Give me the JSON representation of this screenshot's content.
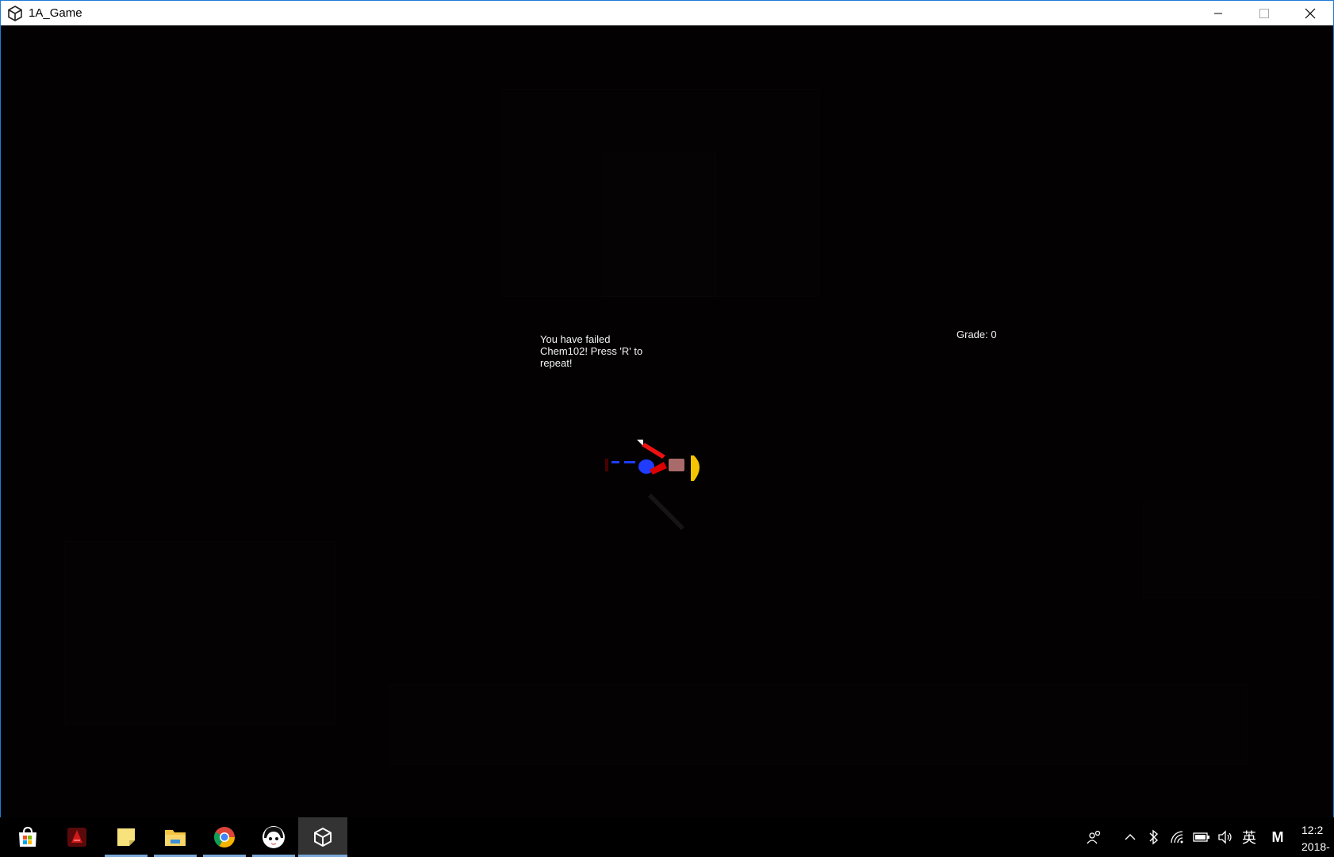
{
  "window": {
    "title": "1A_Game",
    "controls": [
      "minimize-icon",
      "maximize-icon",
      "close-icon"
    ]
  },
  "game": {
    "fail_message": "You have failed Chem102! Press 'R' to repeat!",
    "grade_label": "Grade: 0"
  },
  "taskbar": {
    "apps": [
      {
        "name": "microsoft-store-icon",
        "running": false
      },
      {
        "name": "red-app-icon",
        "running": false
      },
      {
        "name": "sticky-notes-icon",
        "running": true
      },
      {
        "name": "file-explorer-icon",
        "running": true
      },
      {
        "name": "chrome-icon",
        "running": true
      },
      {
        "name": "anime-avatar-icon",
        "running": true
      },
      {
        "name": "unity-icon",
        "running": true,
        "active": true
      }
    ],
    "tray": {
      "people_icon": "people-icon",
      "chevron_icon": "chevron-up-icon",
      "input_label": "英",
      "ime_label": "M"
    },
    "clock": {
      "time": "12:2",
      "date": "2018-"
    }
  },
  "colors": {
    "window_border": "#1e7bd8",
    "game_bg": "#030101",
    "taskbar_bg": "#000000",
    "accent_underline": "#7aa7d8"
  }
}
